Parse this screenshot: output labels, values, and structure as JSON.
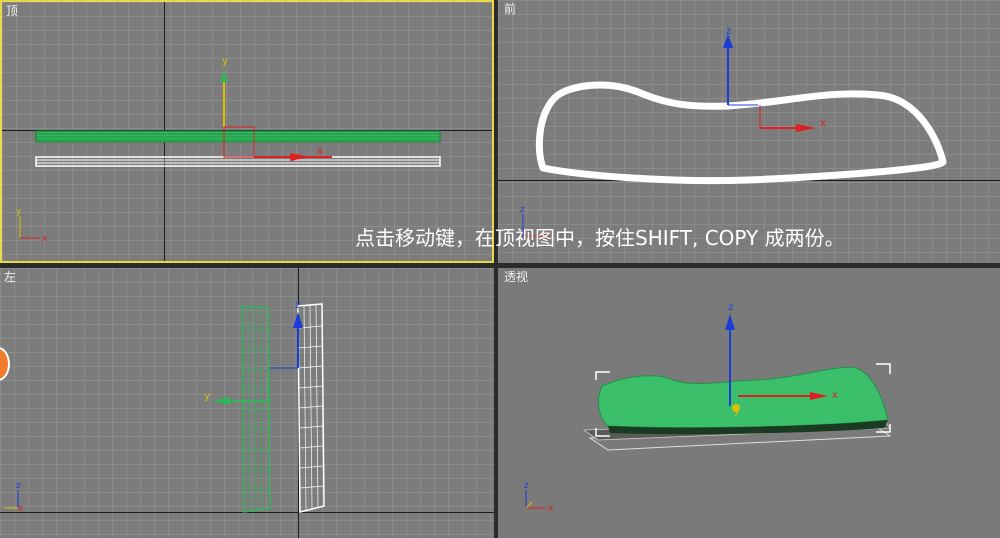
{
  "viewports": {
    "top": {
      "label": "顶"
    },
    "front": {
      "label": "前"
    },
    "left": {
      "label": "左"
    },
    "perspective": {
      "label": "透视"
    }
  },
  "axis_labels": {
    "x": "x",
    "y": "y",
    "z": "z"
  },
  "caption": "点击移动键，在顶视图中，按住SHIFT, COPY 成两份。",
  "colors": {
    "active_border": "#e8d84a",
    "selected_object": "#2fb55b",
    "axis_x": "#e02020",
    "axis_y": "#d8c000",
    "axis_z": "#1a3cd8",
    "wireframe": "#ffffff"
  }
}
